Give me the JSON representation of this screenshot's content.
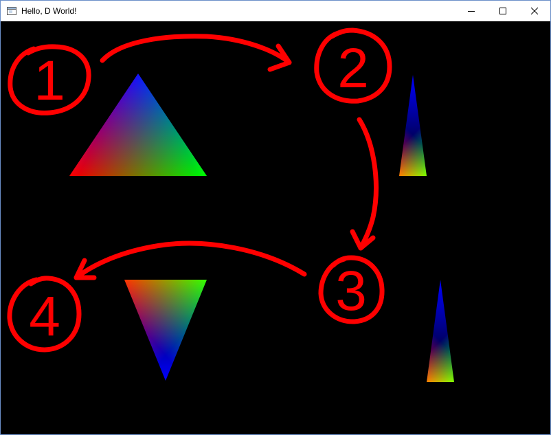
{
  "window": {
    "title": "Hello, D World!"
  },
  "icons": {
    "app": "window-app-icon",
    "minimize": "minimize-icon",
    "maximize": "maximize-icon",
    "close": "close-icon"
  },
  "annotations": {
    "labels": [
      "1",
      "2",
      "3",
      "4"
    ],
    "color": "#ff0000"
  },
  "triangle_colors": {
    "red": "#ff0000",
    "green": "#00ff00",
    "blue": "#0000ff"
  },
  "colors": {
    "background": "#000000",
    "titlebar": "#ffffff",
    "border": "#6b8fc9"
  }
}
